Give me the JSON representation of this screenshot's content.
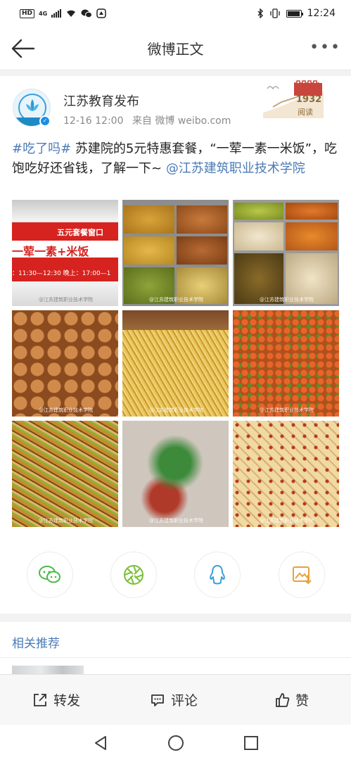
{
  "status": {
    "network": "HD",
    "gen": "4G",
    "time": "12:24"
  },
  "nav": {
    "title": "微博正文"
  },
  "post": {
    "author": "江苏教育发布",
    "date": "12-16 12:00",
    "source": "来自 微博 weibo.com",
    "decoration": {
      "year": "1932",
      "label": "阅读"
    },
    "text_tag": "#吃了吗#",
    "text_body": " 苏建院的5元特惠套餐，“一荤一素一米饭”，吃饱吃好还省钱，了解一下~ ",
    "text_mention": "@江苏建筑职业技术学院",
    "sign": {
      "line1": "五元套餐窗口",
      "line2": "一荤一素+米饭",
      "line3": "：11:30—12:30 晚上：17:00—1"
    },
    "watermark": "@江苏建筑职业技术学院"
  },
  "share": [
    "wechat-icon",
    "moments-icon",
    "qq-icon",
    "save-image-icon"
  ],
  "related": {
    "title": "相关推荐"
  },
  "actions": {
    "repost": "转发",
    "comment": "评论",
    "like": "赞"
  },
  "colors": {
    "link": "#4a7bb5",
    "verified": "#1a8fe6"
  }
}
